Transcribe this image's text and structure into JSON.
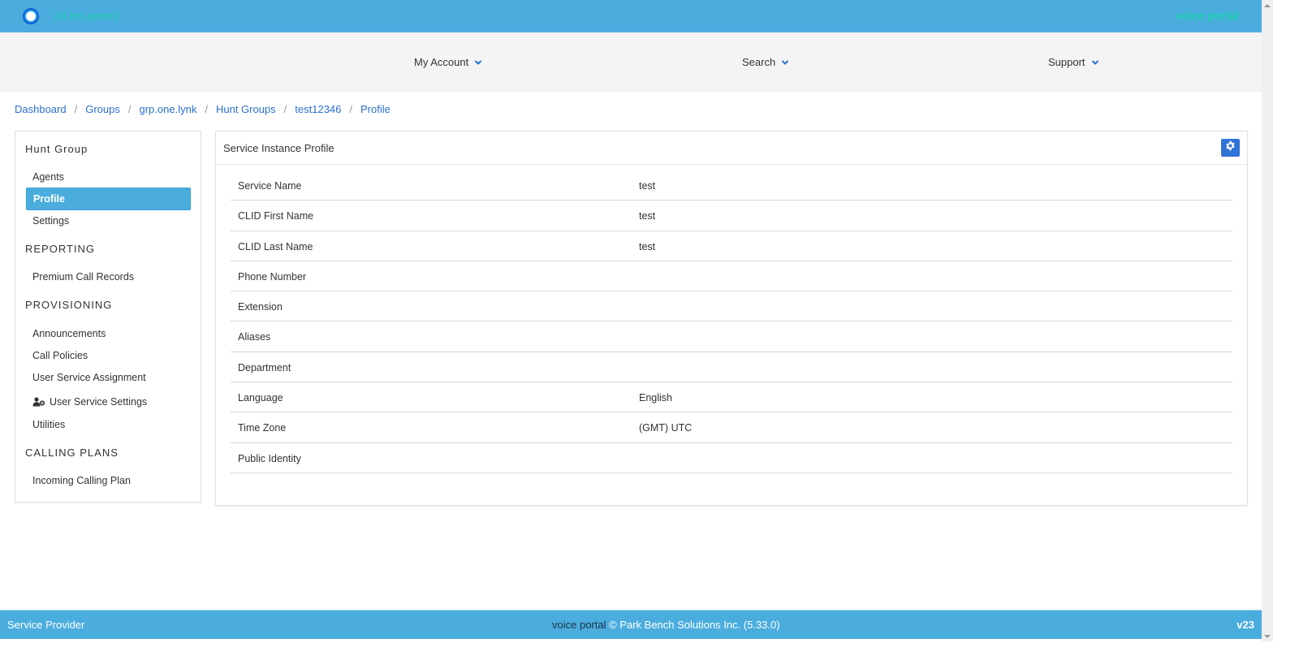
{
  "topbar": {
    "user_label": "(ol.ent.admin)",
    "brand": "voice portal"
  },
  "nav": {
    "items": [
      {
        "label": "My Account",
        "icon": "chevron-down-icon"
      },
      {
        "label": "Search",
        "icon": "chevron-down-icon"
      },
      {
        "label": "Support",
        "icon": "chevron-down-icon"
      }
    ]
  },
  "breadcrumb": [
    "Dashboard",
    "Groups",
    "grp.one.lynk",
    "Hunt Groups",
    "test12346",
    "Profile"
  ],
  "breadcrumb_separator": "/",
  "sidebar": {
    "sections": [
      {
        "heading": "Hunt Group",
        "items": [
          {
            "label": "Agents",
            "active": false
          },
          {
            "label": "Profile",
            "active": true
          },
          {
            "label": "Settings",
            "active": false
          }
        ]
      },
      {
        "heading": "REPORTING",
        "items": [
          {
            "label": "Premium Call Records",
            "active": false
          }
        ]
      },
      {
        "heading": "PROVISIONING",
        "items": [
          {
            "label": "Announcements",
            "active": false
          },
          {
            "label": "Call Policies",
            "active": false
          },
          {
            "label": "User Service Assignment",
            "active": false
          },
          {
            "label": "User Service Settings",
            "active": false,
            "icon": "user-gear-icon"
          },
          {
            "label": "Utilities",
            "active": false
          }
        ]
      },
      {
        "heading": "CALLING PLANS",
        "items": [
          {
            "label": "Incoming Calling Plan",
            "active": false
          }
        ]
      }
    ]
  },
  "panel": {
    "title": "Service Instance Profile",
    "settings_icon": "gear-icon",
    "rows": [
      {
        "label": "Service Name",
        "value": "test"
      },
      {
        "label": "CLID First Name",
        "value": "test"
      },
      {
        "label": "CLID Last Name",
        "value": "test"
      },
      {
        "label": "Phone Number",
        "value": ""
      },
      {
        "label": "Extension",
        "value": ""
      },
      {
        "label": "Aliases",
        "value": ""
      },
      {
        "label": "Department",
        "value": ""
      },
      {
        "label": "Language",
        "value": "English"
      },
      {
        "label": "Time Zone",
        "value": "(GMT) UTC"
      },
      {
        "label": "Public Identity",
        "value": ""
      }
    ]
  },
  "footer": {
    "left": "Service Provider",
    "center_brand": "voice portal",
    "center_copyright": "© Park Bench Solutions Inc. (5.33.0)",
    "right": "v23"
  },
  "colors": {
    "header_blue": "#4aadde",
    "accent_teal": "#20d2b0",
    "link_blue": "#2b6fd0",
    "button_blue": "#2f74d6"
  }
}
